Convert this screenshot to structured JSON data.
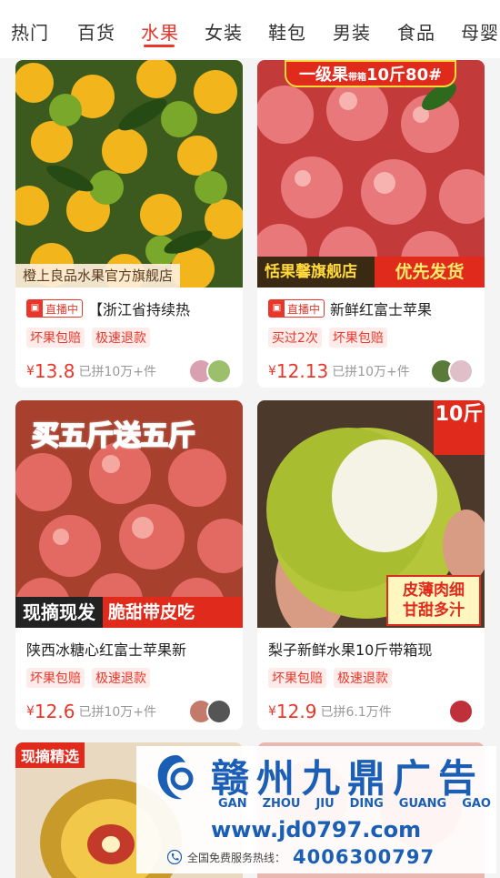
{
  "tabs": [
    {
      "label": "热门",
      "active": false
    },
    {
      "label": "百货",
      "active": false
    },
    {
      "label": "水果",
      "active": true
    },
    {
      "label": "女装",
      "active": false
    },
    {
      "label": "鞋包",
      "active": false
    },
    {
      "label": "男装",
      "active": false
    },
    {
      "label": "食品",
      "active": false
    },
    {
      "label": "母婴",
      "active": false
    }
  ],
  "products": [
    {
      "image_overlay": {
        "shop": "橙上良品水果官方旗舰店"
      },
      "live_label": "直播中",
      "title": "【浙江省持续热",
      "tags": [
        "坏果包赔",
        "极速退款"
      ],
      "currency": "¥",
      "price": "13.8",
      "sold": "已拼10万+件"
    },
    {
      "image_overlay": {
        "top_banner": "一级果",
        "top_banner_small": "带箱",
        "top_banner_rest": "10斤80#",
        "shop": "恬果馨旗舰店",
        "bottom_right": "优先发货"
      },
      "live_label": "直播中",
      "title": "新鲜红富士苹果",
      "tags": [
        "买过2次",
        "坏果包赔"
      ],
      "currency": "¥",
      "price": "12.13",
      "sold": "已拼10万+件"
    },
    {
      "image_overlay": {
        "promo": "买五斤送五斤",
        "bottom_left": "现摘现发",
        "bottom_right": "脆甜带皮吃"
      },
      "title": "陕西冰糖心红富士苹果新",
      "tags": [
        "坏果包赔",
        "极速退款"
      ],
      "currency": "¥",
      "price": "12.6",
      "sold": "已拼10万+件"
    },
    {
      "image_overlay": {
        "corner": "10斤",
        "tag_line1": "皮薄肉细",
        "tag_line2": "甘甜多汁"
      },
      "title": "梨子新鲜水果10斤带箱现",
      "tags": [
        "坏果包赔",
        "极速退款"
      ],
      "currency": "¥",
      "price": "12.9",
      "sold": "已拼6.1万件"
    },
    {
      "image_overlay": {
        "pick_tag": "现摘精选"
      }
    }
  ],
  "ad": {
    "name_cn": "赣州九鼎广告",
    "name_pinyin": [
      "GAN",
      "ZHOU",
      "JIU",
      "DING",
      "GUANG",
      "GAO"
    ],
    "url": "www.jd0797.com",
    "phone_label": "全国免费服务热线：",
    "phone": "4006300797"
  },
  "colors": {
    "accent": "#e8372a",
    "ad_blue": "#1a5eb5"
  }
}
